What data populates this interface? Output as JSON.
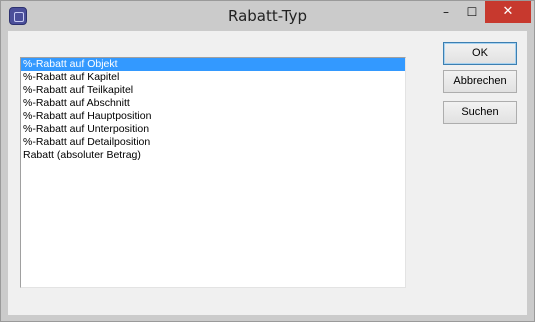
{
  "window": {
    "title": "Rabatt-Typ",
    "icon": "app-icon",
    "controls": {
      "minimize": "–",
      "maximize": "☐",
      "close": "✕"
    }
  },
  "list": {
    "items": [
      "%-Rabatt auf Objekt",
      "%-Rabatt auf Kapitel",
      "%-Rabatt auf Teilkapitel",
      "%-Rabatt auf Abschnitt",
      "%-Rabatt auf Hauptposition",
      "%-Rabatt auf Unterposition",
      "%-Rabatt auf Detailposition",
      "Rabatt (absoluter Betrag)"
    ],
    "selected": 0
  },
  "buttons": {
    "ok": "OK",
    "cancel": "Abbrechen",
    "search": "Suchen"
  },
  "colors": {
    "selection": "#3399ff",
    "close_button": "#c7392e"
  }
}
